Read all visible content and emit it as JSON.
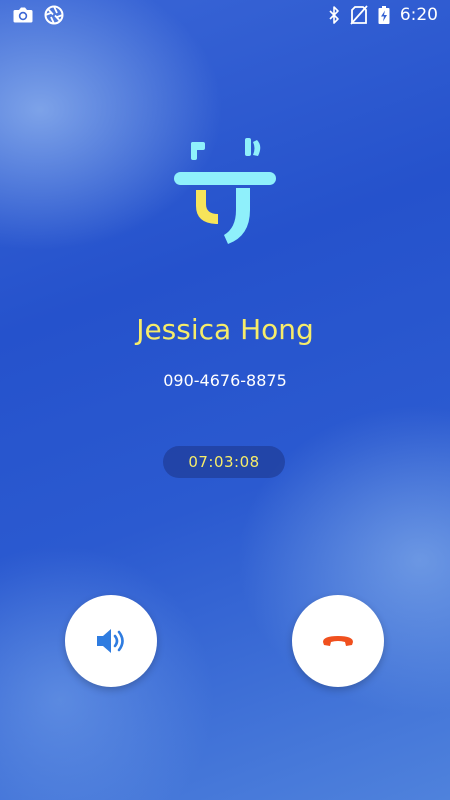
{
  "status_bar": {
    "time": "6:20",
    "left_icons": [
      "camera-icon",
      "shutter-icon"
    ],
    "right_icons": [
      "bluetooth-icon",
      "no-sim-icon",
      "battery-charging-icon"
    ]
  },
  "call": {
    "caller_name": "Jessica Hong",
    "phone_number": "090-4676-8875",
    "duration": "07:03:08"
  },
  "controls": {
    "speaker_icon": "speaker-icon",
    "end_call_icon": "end-call-icon"
  },
  "colors": {
    "name_text": "#f6ec6a",
    "timer_text": "#f6ec6a",
    "end_call": "#f0501e",
    "speaker": "#2f7ce0",
    "logo_cyan": "#8ff0fb",
    "logo_yellow": "#f6e45a"
  }
}
